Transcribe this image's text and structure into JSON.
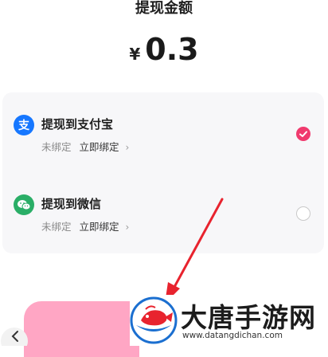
{
  "header": {
    "title": "提现金额"
  },
  "amount": {
    "currency": "¥",
    "value": "0.3"
  },
  "options": [
    {
      "label": "提现到支付宝",
      "status": "未绑定",
      "action": "立即绑定",
      "chevron": "›",
      "selected": true,
      "icon": "alipay-icon"
    },
    {
      "label": "提现到微信",
      "status": "未绑定",
      "action": "立即绑定",
      "chevron": "›",
      "selected": false,
      "icon": "wechat-icon"
    }
  ],
  "colors": {
    "accent": "#f03a6e",
    "alipay": "#1677ff",
    "wechat": "#2aae67",
    "button": "#ffa6c4",
    "annotation_arrow": "#e8232e"
  },
  "watermark": {
    "title": "大唐手游网",
    "url": "www.datangdichan.com"
  }
}
